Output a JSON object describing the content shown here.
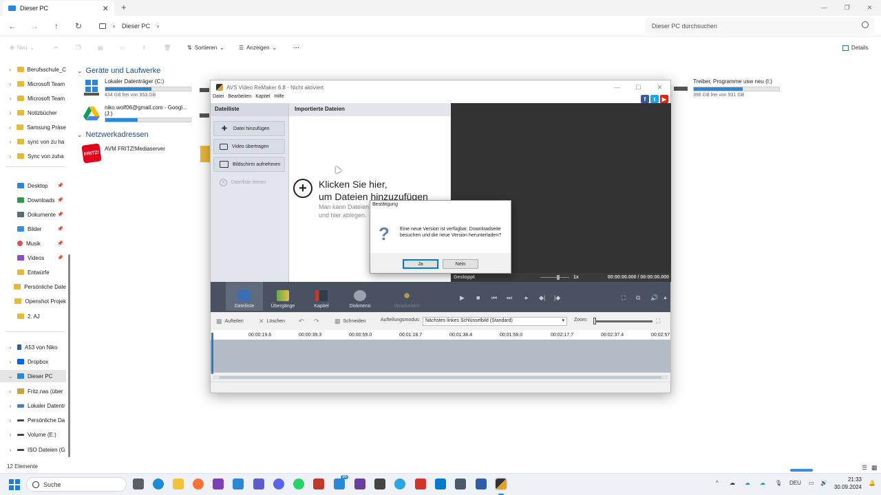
{
  "explorer": {
    "tab_title": "Dieser PC",
    "breadcrumb": "Dieser PC",
    "search_placeholder": "Dieser PC durchsuchen",
    "commands": {
      "new": "Neu",
      "sort": "Sortieren",
      "view": "Anzeigen",
      "more": "···",
      "details": "Details"
    },
    "nav_items": [
      {
        "label": "Berufsschule_C",
        "icon": "folder-icon"
      },
      {
        "label": "Microsoft Team",
        "icon": "folder-icon"
      },
      {
        "label": "Microsoft Team",
        "icon": "folder-icon"
      },
      {
        "label": "Notizbücher",
        "icon": "folder-icon"
      },
      {
        "label": "Samsung Präse",
        "icon": "folder-icon"
      },
      {
        "label": "sync von zu ha",
        "icon": "folder-icon"
      },
      {
        "label": "Sync von zuha",
        "icon": "folder-icon"
      }
    ],
    "quick_access": [
      {
        "label": "Desktop",
        "icon": "desktop-icon"
      },
      {
        "label": "Downloads",
        "icon": "download-icon"
      },
      {
        "label": "Dokumente",
        "icon": "document-icon"
      },
      {
        "label": "Bilder",
        "icon": "picture-icon"
      },
      {
        "label": "Musik",
        "icon": "music-icon"
      },
      {
        "label": "Videos",
        "icon": "video-icon"
      },
      {
        "label": "Entwürfe",
        "icon": "folder-icon"
      },
      {
        "label": "Persönliche Date",
        "icon": "folder-icon"
      },
      {
        "label": "Openshot Projek",
        "icon": "folder-icon"
      },
      {
        "label": "2. AJ",
        "icon": "folder-icon"
      }
    ],
    "devices_nav": [
      {
        "label": "A53 von Niko",
        "icon": "phone-icon"
      },
      {
        "label": "Dropbox",
        "icon": "dropbox-icon"
      },
      {
        "label": "Dieser PC",
        "icon": "pc-icon"
      },
      {
        "label": "Fritz.nas (über",
        "icon": "nas-icon"
      },
      {
        "label": "Lokaler Datentr",
        "icon": "drive-icon"
      },
      {
        "label": "Persönliche Da",
        "icon": "drive-icon"
      },
      {
        "label": "Volume (E:)",
        "icon": "drive-icon"
      },
      {
        "label": "ISO Dateien (G",
        "icon": "drive-icon"
      }
    ],
    "section_drives": "Geräte und Laufwerke",
    "section_network": "Netzwerkadressen",
    "drives": [
      {
        "name": "Lokaler Datenträger (C:)",
        "free": "434 GB frei von 953 GB",
        "used_fraction": 0.54
      },
      {
        "name": "niko.wolf06@gmail.com - Googl...",
        "name2": "(J:)",
        "free": "",
        "used_fraction": 0.38
      },
      {
        "name": "Treiber, Programme usw neu (I:)",
        "free": "398 GB frei von 931 GB",
        "used_fraction": 0.57
      }
    ],
    "network_item": "AVM FRITZ!Mediaserver",
    "status": "12 Elemente"
  },
  "avs": {
    "title": "AVS Video ReMaker 6.8 - Nicht aktiviert",
    "menu": [
      "Datei",
      "Bearbeiten",
      "Kapitel",
      "Hilfe"
    ],
    "left_panel_title": "Dateiliste",
    "buttons": {
      "add_file": "Datei hinzufügen",
      "transfer_video": "Video übertragen",
      "record_screen": "Bildschirm aufnehmen",
      "clear_list": "Dateiliste leeren"
    },
    "center_title": "Importierte Dateien",
    "center_main1": "Klicken Sie hier,",
    "center_main2": "um Dateien hinzuzufügen",
    "center_sub1": "Man kann Dateien",
    "center_sub2": "und hier ablegen.",
    "player_status": "Gestoppt",
    "speed": "1x",
    "time": "00:00:00.000 / 00:00:00.000",
    "toolbar": [
      "Dateiliste",
      "Übergänge",
      "Kapitel",
      "Diskmenü",
      "Verarbeiten!"
    ],
    "edit": {
      "split": "Aufteilen",
      "delete": "Löschen",
      "cut": "Schneiden",
      "mode_label": "Aufteilungsmodus:",
      "mode_value": "Nächstes linkes Schlüsselbild (Standard)",
      "zoom_label": "Zoom:"
    },
    "ruler": [
      "00:00:19.6",
      "00:00:39.3",
      "00:00:59.0",
      "00:01:18.7",
      "00:01:38.4",
      "00:01:58.0",
      "00:02:17.7",
      "00:02:37.4",
      "00:02:57"
    ]
  },
  "dialog": {
    "title": "Bestätigung",
    "message": "Eine neue Version ist verfügbar. Downloadseite besuchen und die neue Version herunterladen?",
    "yes": "Ja",
    "no": "Nein"
  },
  "taskbar": {
    "search": "Suche",
    "lang": "DEU",
    "time": "21:33",
    "date": "30.09.2024",
    "badge": "36"
  }
}
